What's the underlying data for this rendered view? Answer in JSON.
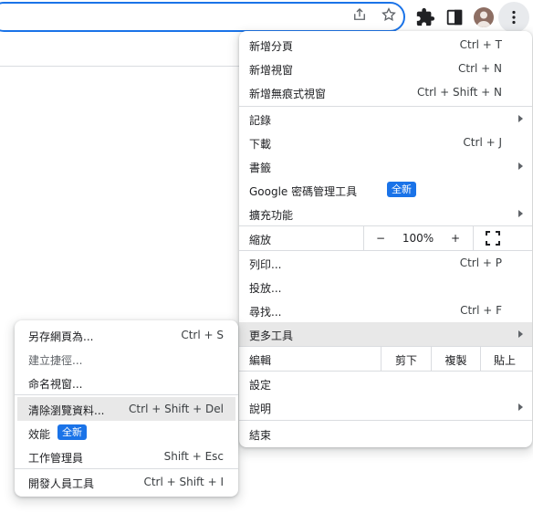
{
  "toolbar": {
    "icons": [
      "share-icon",
      "bookmark-star-icon",
      "extensions-icon",
      "side-panel-icon",
      "profile-avatar",
      "menu-kebab-icon"
    ]
  },
  "main_menu": {
    "new_tab": {
      "label": "新增分頁",
      "shortcut": "Ctrl + T"
    },
    "new_window": {
      "label": "新增視窗",
      "shortcut": "Ctrl + N"
    },
    "new_incognito": {
      "label": "新增無痕式視窗",
      "shortcut": "Ctrl + Shift + N"
    },
    "history": {
      "label": "記錄"
    },
    "downloads": {
      "label": "下載",
      "shortcut": "Ctrl + J"
    },
    "bookmarks": {
      "label": "書籤"
    },
    "password_manager": {
      "label": "Google 密碼管理工具",
      "badge": "全新"
    },
    "extensions": {
      "label": "擴充功能"
    },
    "zoom": {
      "label": "縮放",
      "minus": "−",
      "value": "100%",
      "plus": "+"
    },
    "print": {
      "label": "列印...",
      "shortcut": "Ctrl + P"
    },
    "cast": {
      "label": "投放..."
    },
    "find": {
      "label": "尋找...",
      "shortcut": "Ctrl + F"
    },
    "more_tools": {
      "label": "更多工具"
    },
    "edit": {
      "label": "編輯",
      "cut": "剪下",
      "copy": "複製",
      "paste": "貼上"
    },
    "settings": {
      "label": "設定"
    },
    "help": {
      "label": "說明"
    },
    "exit": {
      "label": "結束"
    }
  },
  "more_tools_menu": {
    "save_page": {
      "label": "另存網頁為...",
      "shortcut": "Ctrl + S"
    },
    "create_shortcut": {
      "label": "建立捷徑..."
    },
    "name_window": {
      "label": "命名視窗..."
    },
    "clear_data": {
      "label": "清除瀏覽資料...",
      "shortcut": "Ctrl + Shift + Del"
    },
    "performance": {
      "label": "效能",
      "badge": "全新"
    },
    "task_manager": {
      "label": "工作管理員",
      "shortcut": "Shift + Esc"
    },
    "dev_tools": {
      "label": "開發人員工具",
      "shortcut": "Ctrl + Shift + I"
    }
  },
  "colors": {
    "accent": "#1a73e8",
    "highlight": "#e8e8e8",
    "separator": "#dadce0",
    "text": "#202124"
  }
}
